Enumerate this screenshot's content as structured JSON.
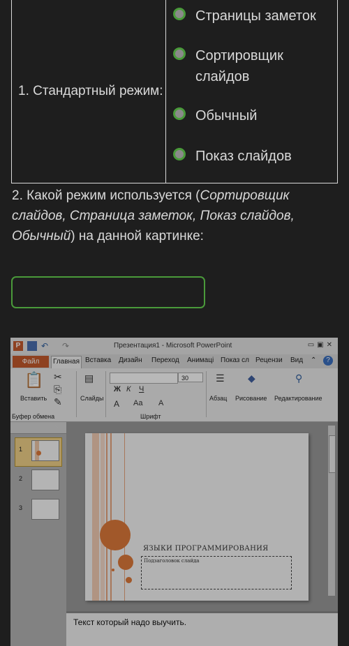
{
  "quiz": {
    "item1_label": "1. Стандартный режим:",
    "options": [
      "Страницы заметок",
      "Сортировщик слайдов",
      "Обычный",
      "Показ слайдов"
    ],
    "question2": {
      "number": "2.",
      "text_a": " Какой режим используется (",
      "italic": "Сортировщик слайдов, Страница заметок, Показ слайдов, Обычный",
      "text_b": ") на данной картинке:"
    },
    "answer_value": ""
  },
  "ppt": {
    "window_title": "Презентация1 - Microsoft PowerPoint",
    "tabs": [
      "Файл",
      "Главная",
      "Вставка",
      "Дизайн",
      "Переход",
      "Анимаці",
      "Показ сл",
      "Рецензи",
      "Вид"
    ],
    "ribbon": {
      "paste": "Вставить",
      "slides": "Слайды",
      "font_size": "30",
      "paragraph": "Абзац",
      "drawing": "Рисование",
      "editing": "Редактирование",
      "clipboard_group": "Буфер обмена",
      "font_group": "Шрифт"
    },
    "thumb_numbers": [
      "1",
      "2",
      "3"
    ],
    "slide": {
      "title": "ЯЗЫКИ ПРОГРАММИРОВАНИЯ",
      "subtitle": "Подзаголовок слайда"
    },
    "notes_text": "Текст который надо выучить.",
    "colors": {
      "accent_orange": "#e07a3a",
      "file_tab": "#c55a2c",
      "radio_border": "#4a9a3a"
    }
  }
}
